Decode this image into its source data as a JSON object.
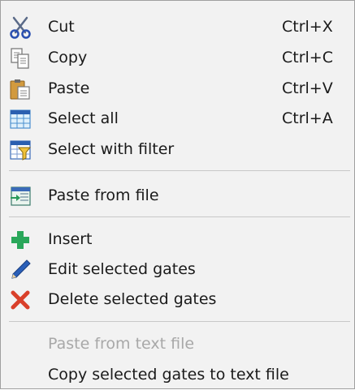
{
  "menu": {
    "items": [
      {
        "label": "Cut",
        "shortcut": "Ctrl+X",
        "icon": "scissors-icon"
      },
      {
        "label": "Copy",
        "shortcut": "Ctrl+C",
        "icon": "copy-icon"
      },
      {
        "label": "Paste",
        "shortcut": "Ctrl+V",
        "icon": "paste-icon"
      },
      {
        "label": "Select all",
        "shortcut": "Ctrl+A",
        "icon": "grid-select-icon"
      },
      {
        "label": "Select with filter",
        "icon": "filter-grid-icon"
      },
      {
        "label": "Paste from file",
        "icon": "paste-file-icon"
      },
      {
        "label": "Insert",
        "icon": "plus-icon"
      },
      {
        "label": "Edit selected gates",
        "icon": "pencil-icon"
      },
      {
        "label": "Delete selected gates",
        "icon": "x-icon"
      },
      {
        "label": "Paste from text file",
        "disabled": true
      },
      {
        "label": "Copy selected gates to text file"
      }
    ]
  }
}
